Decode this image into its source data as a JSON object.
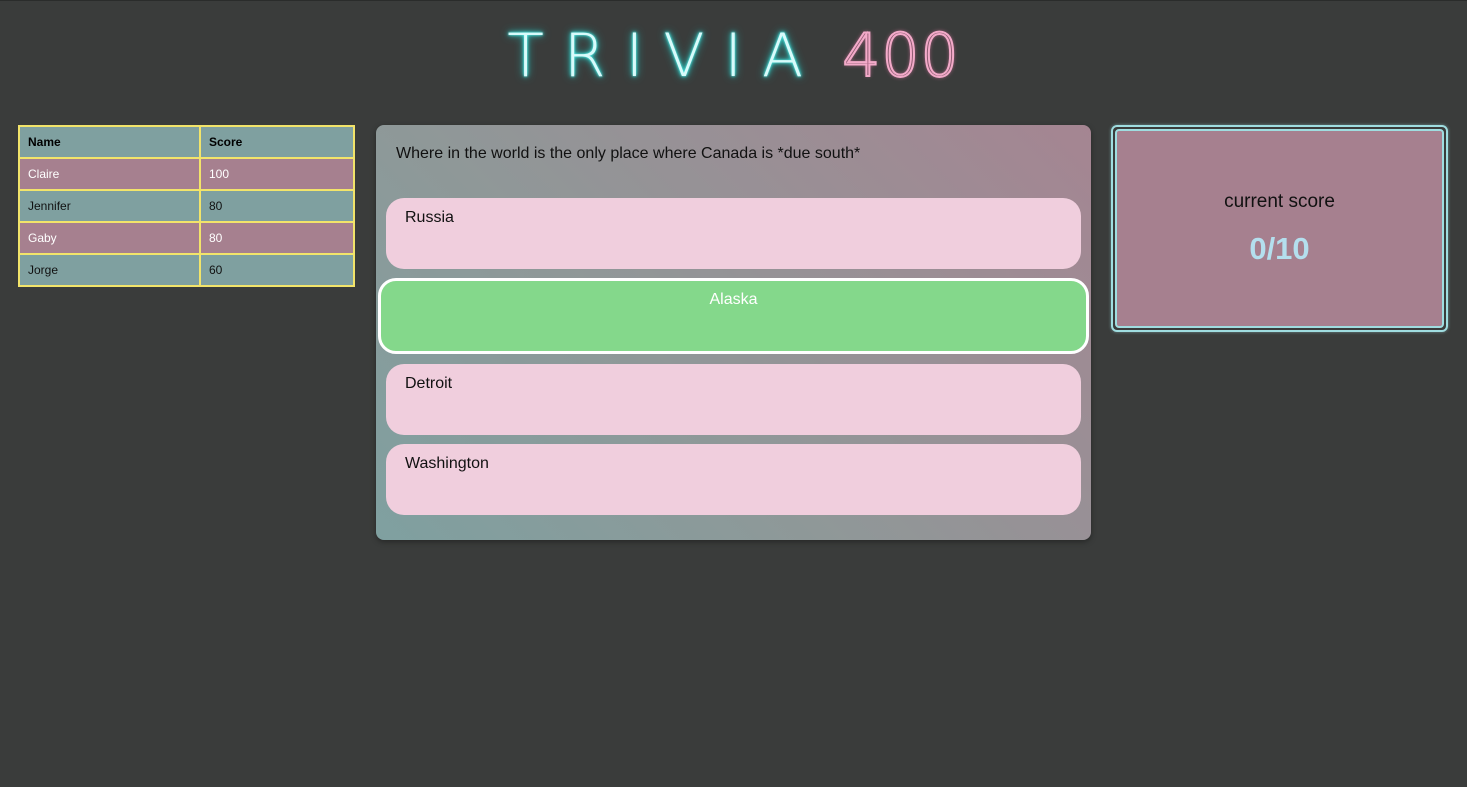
{
  "header": {
    "title_word": "TRIVIA",
    "title_number": "400"
  },
  "leaderboard": {
    "columns": [
      "Name",
      "Score"
    ],
    "rows": [
      {
        "name": "Claire",
        "score": "100"
      },
      {
        "name": "Jennifer",
        "score": "80"
      },
      {
        "name": "Gaby",
        "score": "80"
      },
      {
        "name": "Jorge",
        "score": "60"
      }
    ]
  },
  "question": {
    "text": "Where in the world is the only place where Canada is *due south*",
    "answers": [
      {
        "label": "Russia",
        "state": "default"
      },
      {
        "label": "Alaska",
        "state": "correct"
      },
      {
        "label": "Detroit",
        "state": "default"
      },
      {
        "label": "Washington",
        "state": "default"
      }
    ]
  },
  "score": {
    "label": "current score",
    "value": "0/10"
  },
  "colors": {
    "background": "#3a3c3b",
    "teal": "#7fa0a0",
    "rose": "#a6808f",
    "answer": "#f0cedd",
    "correct": "#84d88b",
    "table_border": "#f2e46a",
    "neon_cyan": "#33e6e0",
    "neon_pink": "#f3aac9",
    "score_value": "#b4dfee"
  }
}
